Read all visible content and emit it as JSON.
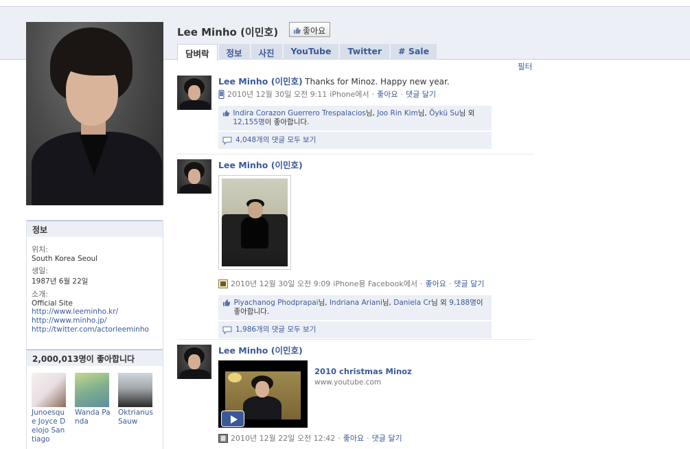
{
  "page": {
    "title": "Lee Minho (이민호)",
    "like_button": "좋아요",
    "tabs": [
      "담벼락",
      "정보",
      "사진",
      "YouTube",
      "Twitter",
      "# Sale"
    ],
    "filter_label": "필터"
  },
  "info": {
    "heading": "정보",
    "location_label": "위치:",
    "location_value": "South Korea Seoul",
    "birthday_label": "생일:",
    "birthday_value": "1987년 6월 22일",
    "about_label": "소개:",
    "official_site": "Official Site",
    "links": [
      "http://www.leeminho.kr/",
      "http://www.minho.jp/",
      "http://twitter.com/actorleeminho"
    ]
  },
  "likes": {
    "heading": "2,000,013명이 좋아합니다",
    "fans": [
      {
        "name": "Junoesque Joyce Delojo Santiago"
      },
      {
        "name": "Wanda Panda"
      },
      {
        "name": "Oktrianus Sauw"
      }
    ]
  },
  "stories": [
    {
      "actor": "Lee Minho (이민호)",
      "message": "Thanks for Minoz. Happy new year.",
      "time": "2010년 12월 30일 오전 9:11",
      "source": "iPhone에서",
      "like_action": "좋아요",
      "comment_action": "댓글 달기",
      "likers": [
        "Indira Corazon Guerrero Trespalacios",
        "Joo Rin Kim",
        "Öykü Su"
      ],
      "likers_sep": "님,",
      "likers_last_sep": "님",
      "others_prefix": "외",
      "others_count": "12,155명",
      "likes_suffix": "이 좋아합니다.",
      "comments_link": "4,048개의 댓글 모두 보기"
    },
    {
      "actor": "Lee Minho (이민호)",
      "time": "2010년 12월 30일 오전 9:09",
      "source": "iPhone용 Facebook에서",
      "like_action": "좋아요",
      "comment_action": "댓글 달기",
      "likers": [
        "Piyachanog Phodprapai",
        "Indriana Ariani",
        "Daniela Cr"
      ],
      "likers_sep": "님,",
      "likers_last_sep": "님",
      "others_prefix": "외",
      "others_count": "9,188명",
      "likes_suffix": "이 좋아합니다.",
      "comments_link": "1,986개의 댓글 모두 보기"
    },
    {
      "actor": "Lee Minho (이민호)",
      "video_title": "2010 christmas Minoz",
      "video_source": "www.youtube.com",
      "time": "2010년 12월 22일 오전 12:42",
      "like_action": "좋아요",
      "comment_action": "댓글 달기"
    }
  ],
  "meta_sep": "·",
  "colors": {
    "link": "#3b5998",
    "header_band": "#eceff5"
  }
}
